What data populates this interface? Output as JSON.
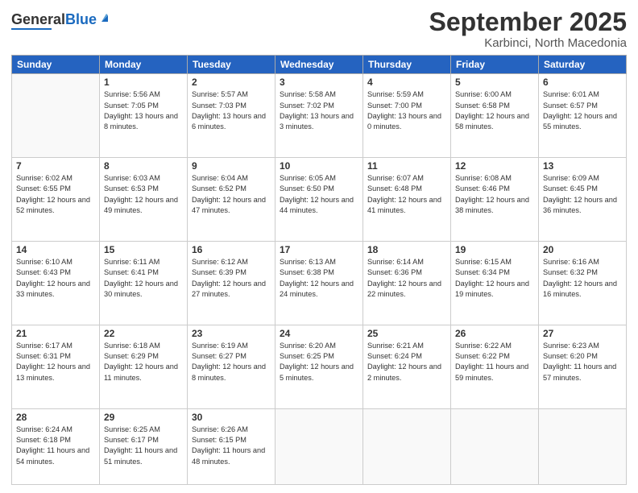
{
  "logo": {
    "general": "General",
    "blue": "Blue"
  },
  "header": {
    "month": "September 2025",
    "location": "Karbinci, North Macedonia"
  },
  "weekdays": [
    "Sunday",
    "Monday",
    "Tuesday",
    "Wednesday",
    "Thursday",
    "Friday",
    "Saturday"
  ],
  "weeks": [
    [
      {
        "day": null
      },
      {
        "day": 1,
        "sunrise": "5:56 AM",
        "sunset": "7:05 PM",
        "daylight": "13 hours and 8 minutes."
      },
      {
        "day": 2,
        "sunrise": "5:57 AM",
        "sunset": "7:03 PM",
        "daylight": "13 hours and 6 minutes."
      },
      {
        "day": 3,
        "sunrise": "5:58 AM",
        "sunset": "7:02 PM",
        "daylight": "13 hours and 3 minutes."
      },
      {
        "day": 4,
        "sunrise": "5:59 AM",
        "sunset": "7:00 PM",
        "daylight": "13 hours and 0 minutes."
      },
      {
        "day": 5,
        "sunrise": "6:00 AM",
        "sunset": "6:58 PM",
        "daylight": "12 hours and 58 minutes."
      },
      {
        "day": 6,
        "sunrise": "6:01 AM",
        "sunset": "6:57 PM",
        "daylight": "12 hours and 55 minutes."
      }
    ],
    [
      {
        "day": 7,
        "sunrise": "6:02 AM",
        "sunset": "6:55 PM",
        "daylight": "12 hours and 52 minutes."
      },
      {
        "day": 8,
        "sunrise": "6:03 AM",
        "sunset": "6:53 PM",
        "daylight": "12 hours and 49 minutes."
      },
      {
        "day": 9,
        "sunrise": "6:04 AM",
        "sunset": "6:52 PM",
        "daylight": "12 hours and 47 minutes."
      },
      {
        "day": 10,
        "sunrise": "6:05 AM",
        "sunset": "6:50 PM",
        "daylight": "12 hours and 44 minutes."
      },
      {
        "day": 11,
        "sunrise": "6:07 AM",
        "sunset": "6:48 PM",
        "daylight": "12 hours and 41 minutes."
      },
      {
        "day": 12,
        "sunrise": "6:08 AM",
        "sunset": "6:46 PM",
        "daylight": "12 hours and 38 minutes."
      },
      {
        "day": 13,
        "sunrise": "6:09 AM",
        "sunset": "6:45 PM",
        "daylight": "12 hours and 36 minutes."
      }
    ],
    [
      {
        "day": 14,
        "sunrise": "6:10 AM",
        "sunset": "6:43 PM",
        "daylight": "12 hours and 33 minutes."
      },
      {
        "day": 15,
        "sunrise": "6:11 AM",
        "sunset": "6:41 PM",
        "daylight": "12 hours and 30 minutes."
      },
      {
        "day": 16,
        "sunrise": "6:12 AM",
        "sunset": "6:39 PM",
        "daylight": "12 hours and 27 minutes."
      },
      {
        "day": 17,
        "sunrise": "6:13 AM",
        "sunset": "6:38 PM",
        "daylight": "12 hours and 24 minutes."
      },
      {
        "day": 18,
        "sunrise": "6:14 AM",
        "sunset": "6:36 PM",
        "daylight": "12 hours and 22 minutes."
      },
      {
        "day": 19,
        "sunrise": "6:15 AM",
        "sunset": "6:34 PM",
        "daylight": "12 hours and 19 minutes."
      },
      {
        "day": 20,
        "sunrise": "6:16 AM",
        "sunset": "6:32 PM",
        "daylight": "12 hours and 16 minutes."
      }
    ],
    [
      {
        "day": 21,
        "sunrise": "6:17 AM",
        "sunset": "6:31 PM",
        "daylight": "12 hours and 13 minutes."
      },
      {
        "day": 22,
        "sunrise": "6:18 AM",
        "sunset": "6:29 PM",
        "daylight": "12 hours and 11 minutes."
      },
      {
        "day": 23,
        "sunrise": "6:19 AM",
        "sunset": "6:27 PM",
        "daylight": "12 hours and 8 minutes."
      },
      {
        "day": 24,
        "sunrise": "6:20 AM",
        "sunset": "6:25 PM",
        "daylight": "12 hours and 5 minutes."
      },
      {
        "day": 25,
        "sunrise": "6:21 AM",
        "sunset": "6:24 PM",
        "daylight": "12 hours and 2 minutes."
      },
      {
        "day": 26,
        "sunrise": "6:22 AM",
        "sunset": "6:22 PM",
        "daylight": "11 hours and 59 minutes."
      },
      {
        "day": 27,
        "sunrise": "6:23 AM",
        "sunset": "6:20 PM",
        "daylight": "11 hours and 57 minutes."
      }
    ],
    [
      {
        "day": 28,
        "sunrise": "6:24 AM",
        "sunset": "6:18 PM",
        "daylight": "11 hours and 54 minutes."
      },
      {
        "day": 29,
        "sunrise": "6:25 AM",
        "sunset": "6:17 PM",
        "daylight": "11 hours and 51 minutes."
      },
      {
        "day": 30,
        "sunrise": "6:26 AM",
        "sunset": "6:15 PM",
        "daylight": "11 hours and 48 minutes."
      },
      {
        "day": null
      },
      {
        "day": null
      },
      {
        "day": null
      },
      {
        "day": null
      }
    ]
  ]
}
